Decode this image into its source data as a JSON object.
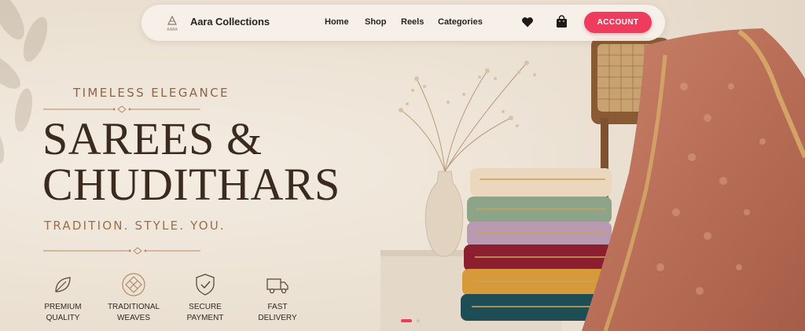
{
  "brand": {
    "name": "Aara Collections",
    "logo_text": "AARA"
  },
  "nav": {
    "items": [
      "Home",
      "Shop",
      "Reels",
      "Categories"
    ],
    "account_label": "ACCOUNT"
  },
  "hero": {
    "eyebrow": "TIMELESS ELEGANCE",
    "title_line1": "SAREES &",
    "title_line2": "CHUDITHARS",
    "tagline": "TRADITION. STYLE. YOU."
  },
  "features": [
    {
      "label": "PREMIUM\nQUALITY",
      "icon": "leaf-icon"
    },
    {
      "label": "TRADITIONAL\nWEAVES",
      "icon": "weave-pattern-icon"
    },
    {
      "label": "SECURE\nPAYMENT",
      "icon": "shield-check-icon"
    },
    {
      "label": "FAST\nDELIVERY",
      "icon": "truck-icon"
    }
  ],
  "carousel": {
    "slides": 2,
    "active_index": 0
  },
  "colors": {
    "accent": "#ee3b5e",
    "heading": "#3b2a1e",
    "subtle": "#9a6f4c",
    "background": "#efe6da"
  }
}
